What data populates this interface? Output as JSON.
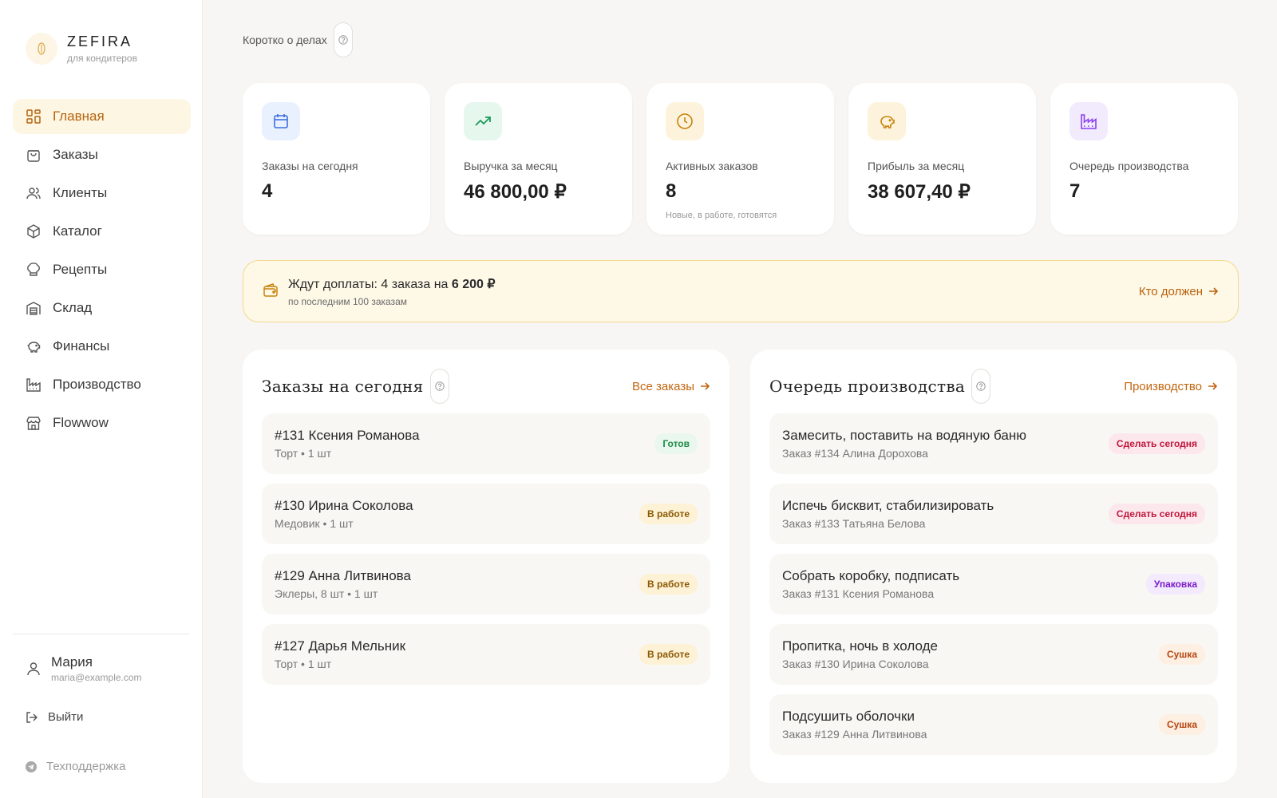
{
  "brand": {
    "name": "ZEFIRA",
    "subtitle": "для кондитеров"
  },
  "nav": [
    {
      "label": "Главная",
      "icon": "grid-icon",
      "active": true
    },
    {
      "label": "Заказы",
      "icon": "shopping-bag-icon"
    },
    {
      "label": "Клиенты",
      "icon": "users-icon"
    },
    {
      "label": "Каталог",
      "icon": "package-icon"
    },
    {
      "label": "Рецепты",
      "icon": "chef-hat-icon"
    },
    {
      "label": "Склад",
      "icon": "warehouse-icon"
    },
    {
      "label": "Финансы",
      "icon": "piggy-bank-icon"
    },
    {
      "label": "Производство",
      "icon": "factory-icon"
    },
    {
      "label": "Flowwow",
      "icon": "store-icon"
    }
  ],
  "user": {
    "name": "Мария",
    "email": "maria@example.com"
  },
  "logout_label": "Выйти",
  "support_label": "Техподдержка",
  "header": {
    "title": "Коротко о делах"
  },
  "stats": [
    {
      "label": "Заказы на сегодня",
      "value": "4",
      "icon": "calendar-icon",
      "hint": ""
    },
    {
      "label": "Выручка за месяц",
      "value": "46 800,00 ₽",
      "icon": "trending-up-icon",
      "hint": ""
    },
    {
      "label": "Активных заказов",
      "value": "8",
      "icon": "clock-icon",
      "hint": "Новые, в работе, готовятся"
    },
    {
      "label": "Прибыль за месяц",
      "value": "38 607,40 ₽",
      "icon": "piggy-bank-icon",
      "hint": ""
    },
    {
      "label": "Очередь производства",
      "value": "7",
      "icon": "factory-icon",
      "hint": ""
    }
  ],
  "banner": {
    "title_prefix": "Ждут доплаты: 4 заказа на ",
    "title_amount": "6 200 ₽",
    "subtitle": "по последним 100 заказам",
    "link": "Кто должен"
  },
  "orders_panel": {
    "title": "Заказы на сегодня",
    "link": "Все заказы",
    "rows": [
      {
        "title": "#131 Ксения Романова",
        "sub": "Торт • 1 шт",
        "badge": "Готов"
      },
      {
        "title": "#130 Ирина Соколова",
        "sub": "Медовик • 1 шт",
        "badge": "В работе"
      },
      {
        "title": "#129 Анна Литвинова",
        "sub": "Эклеры, 8 шт • 1 шт",
        "badge": "В работе"
      },
      {
        "title": "#127 Дарья Мельник",
        "sub": "Торт • 1 шт",
        "badge": "В работе"
      }
    ]
  },
  "queue_panel": {
    "title": "Очередь производства",
    "link": "Производство",
    "rows": [
      {
        "title": "Замесить, поставить на водяную баню",
        "sub": "Заказ #134 Алина Дорохова",
        "badge": "Сделать сегодня"
      },
      {
        "title": "Испечь бисквит, стабилизировать",
        "sub": "Заказ #133 Татьяна Белова",
        "badge": "Сделать сегодня"
      },
      {
        "title": "Собрать коробку, подписать",
        "sub": "Заказ #131 Ксения Романова",
        "badge": "Упаковка"
      },
      {
        "title": "Пропитка, ночь в холоде",
        "sub": "Заказ #130 Ирина Соколова",
        "badge": "Сушка"
      },
      {
        "title": "Подсушить оболочки",
        "sub": "Заказ #129 Анна Литвинова",
        "badge": "Сушка"
      }
    ]
  },
  "colors": {
    "accent": "#b8620b",
    "banner_bg": "#fef8e7",
    "ready": "#1e8a45",
    "in_work": "#8c5a05",
    "today": "#c0163c",
    "packing": "#7a1bc9",
    "drying": "#b6450f"
  }
}
